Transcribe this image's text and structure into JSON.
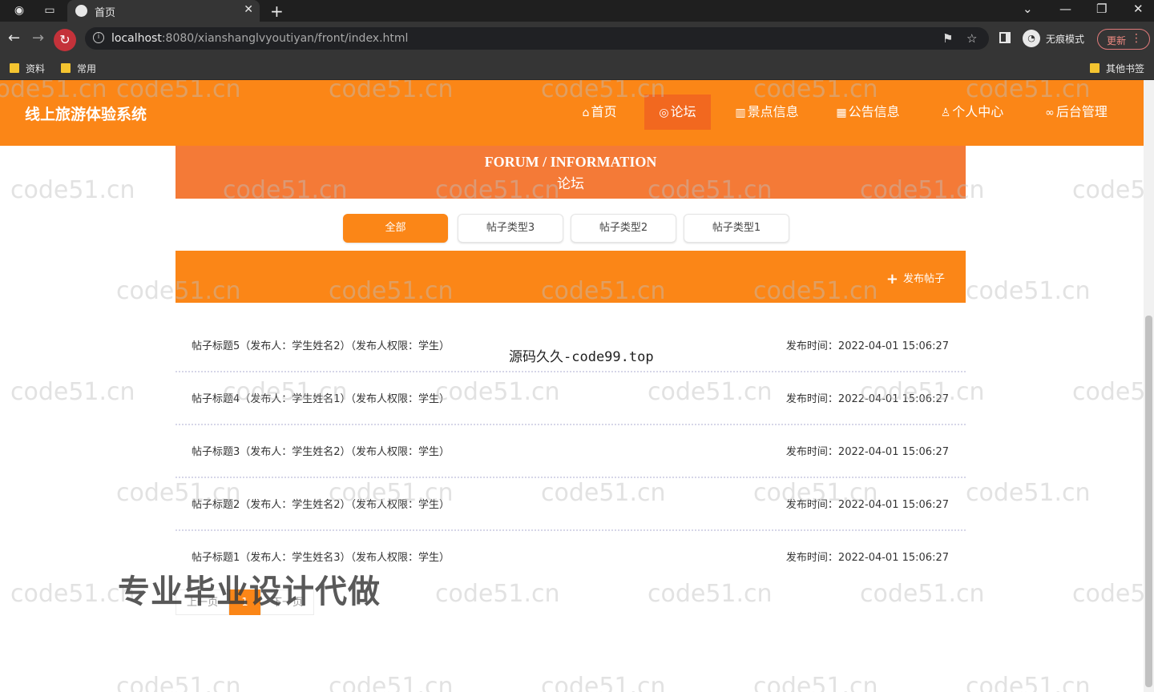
{
  "browser": {
    "tab_title": "首页",
    "url_host": "localhost",
    "url_rest": ":8080/xianshanglvyoutiyan/front/index.html",
    "incognito_label": "无痕模式",
    "update_label": "更新",
    "bookmarks": [
      "资料",
      "常用"
    ],
    "other_bookmarks": "其他书签"
  },
  "site": {
    "title": "线上旅游体验系统",
    "nav": [
      {
        "label": "首页",
        "icon": "home-icon"
      },
      {
        "label": "论坛",
        "icon": "forum-icon"
      },
      {
        "label": "景点信息",
        "icon": "attraction-icon"
      },
      {
        "label": "公告信息",
        "icon": "notice-icon"
      },
      {
        "label": "个人中心",
        "icon": "user-icon"
      },
      {
        "label": "后台管理",
        "icon": "link-icon"
      }
    ]
  },
  "banner": {
    "en": "FORUM / INFORMATION",
    "zh": "论坛"
  },
  "type_tabs": [
    "全部",
    "帖子类型3",
    "帖子类型2",
    "帖子类型1"
  ],
  "post_button": "发布帖子",
  "posts": [
    {
      "title": "帖子标题5（发布人：学生姓名2）（发布人权限：学生）",
      "time": "发布时间：2022-04-01 15:06:27"
    },
    {
      "title": "帖子标题4（发布人：学生姓名1）（发布人权限：学生）",
      "time": "发布时间：2022-04-01 15:06:27"
    },
    {
      "title": "帖子标题3（发布人：学生姓名2）（发布人权限：学生）",
      "time": "发布时间：2022-04-01 15:06:27"
    },
    {
      "title": "帖子标题2（发布人：学生姓名2）（发布人权限：学生）",
      "time": "发布时间：2022-04-01 15:06:27"
    },
    {
      "title": "帖子标题1（发布人：学生姓名3）（发布人权限：学生）",
      "time": "发布时间：2022-04-01 15:06:27"
    }
  ],
  "pagination": {
    "prev": "上一页",
    "current": "1",
    "next": "下一页"
  },
  "watermarks": {
    "site": "code51.cn",
    "center": "源码久久-code99.top",
    "promo": "专业毕业设计代做"
  },
  "colors": {
    "primary": "#fb8617",
    "banner": "#f47a37",
    "nav_active": "#f2681f"
  }
}
